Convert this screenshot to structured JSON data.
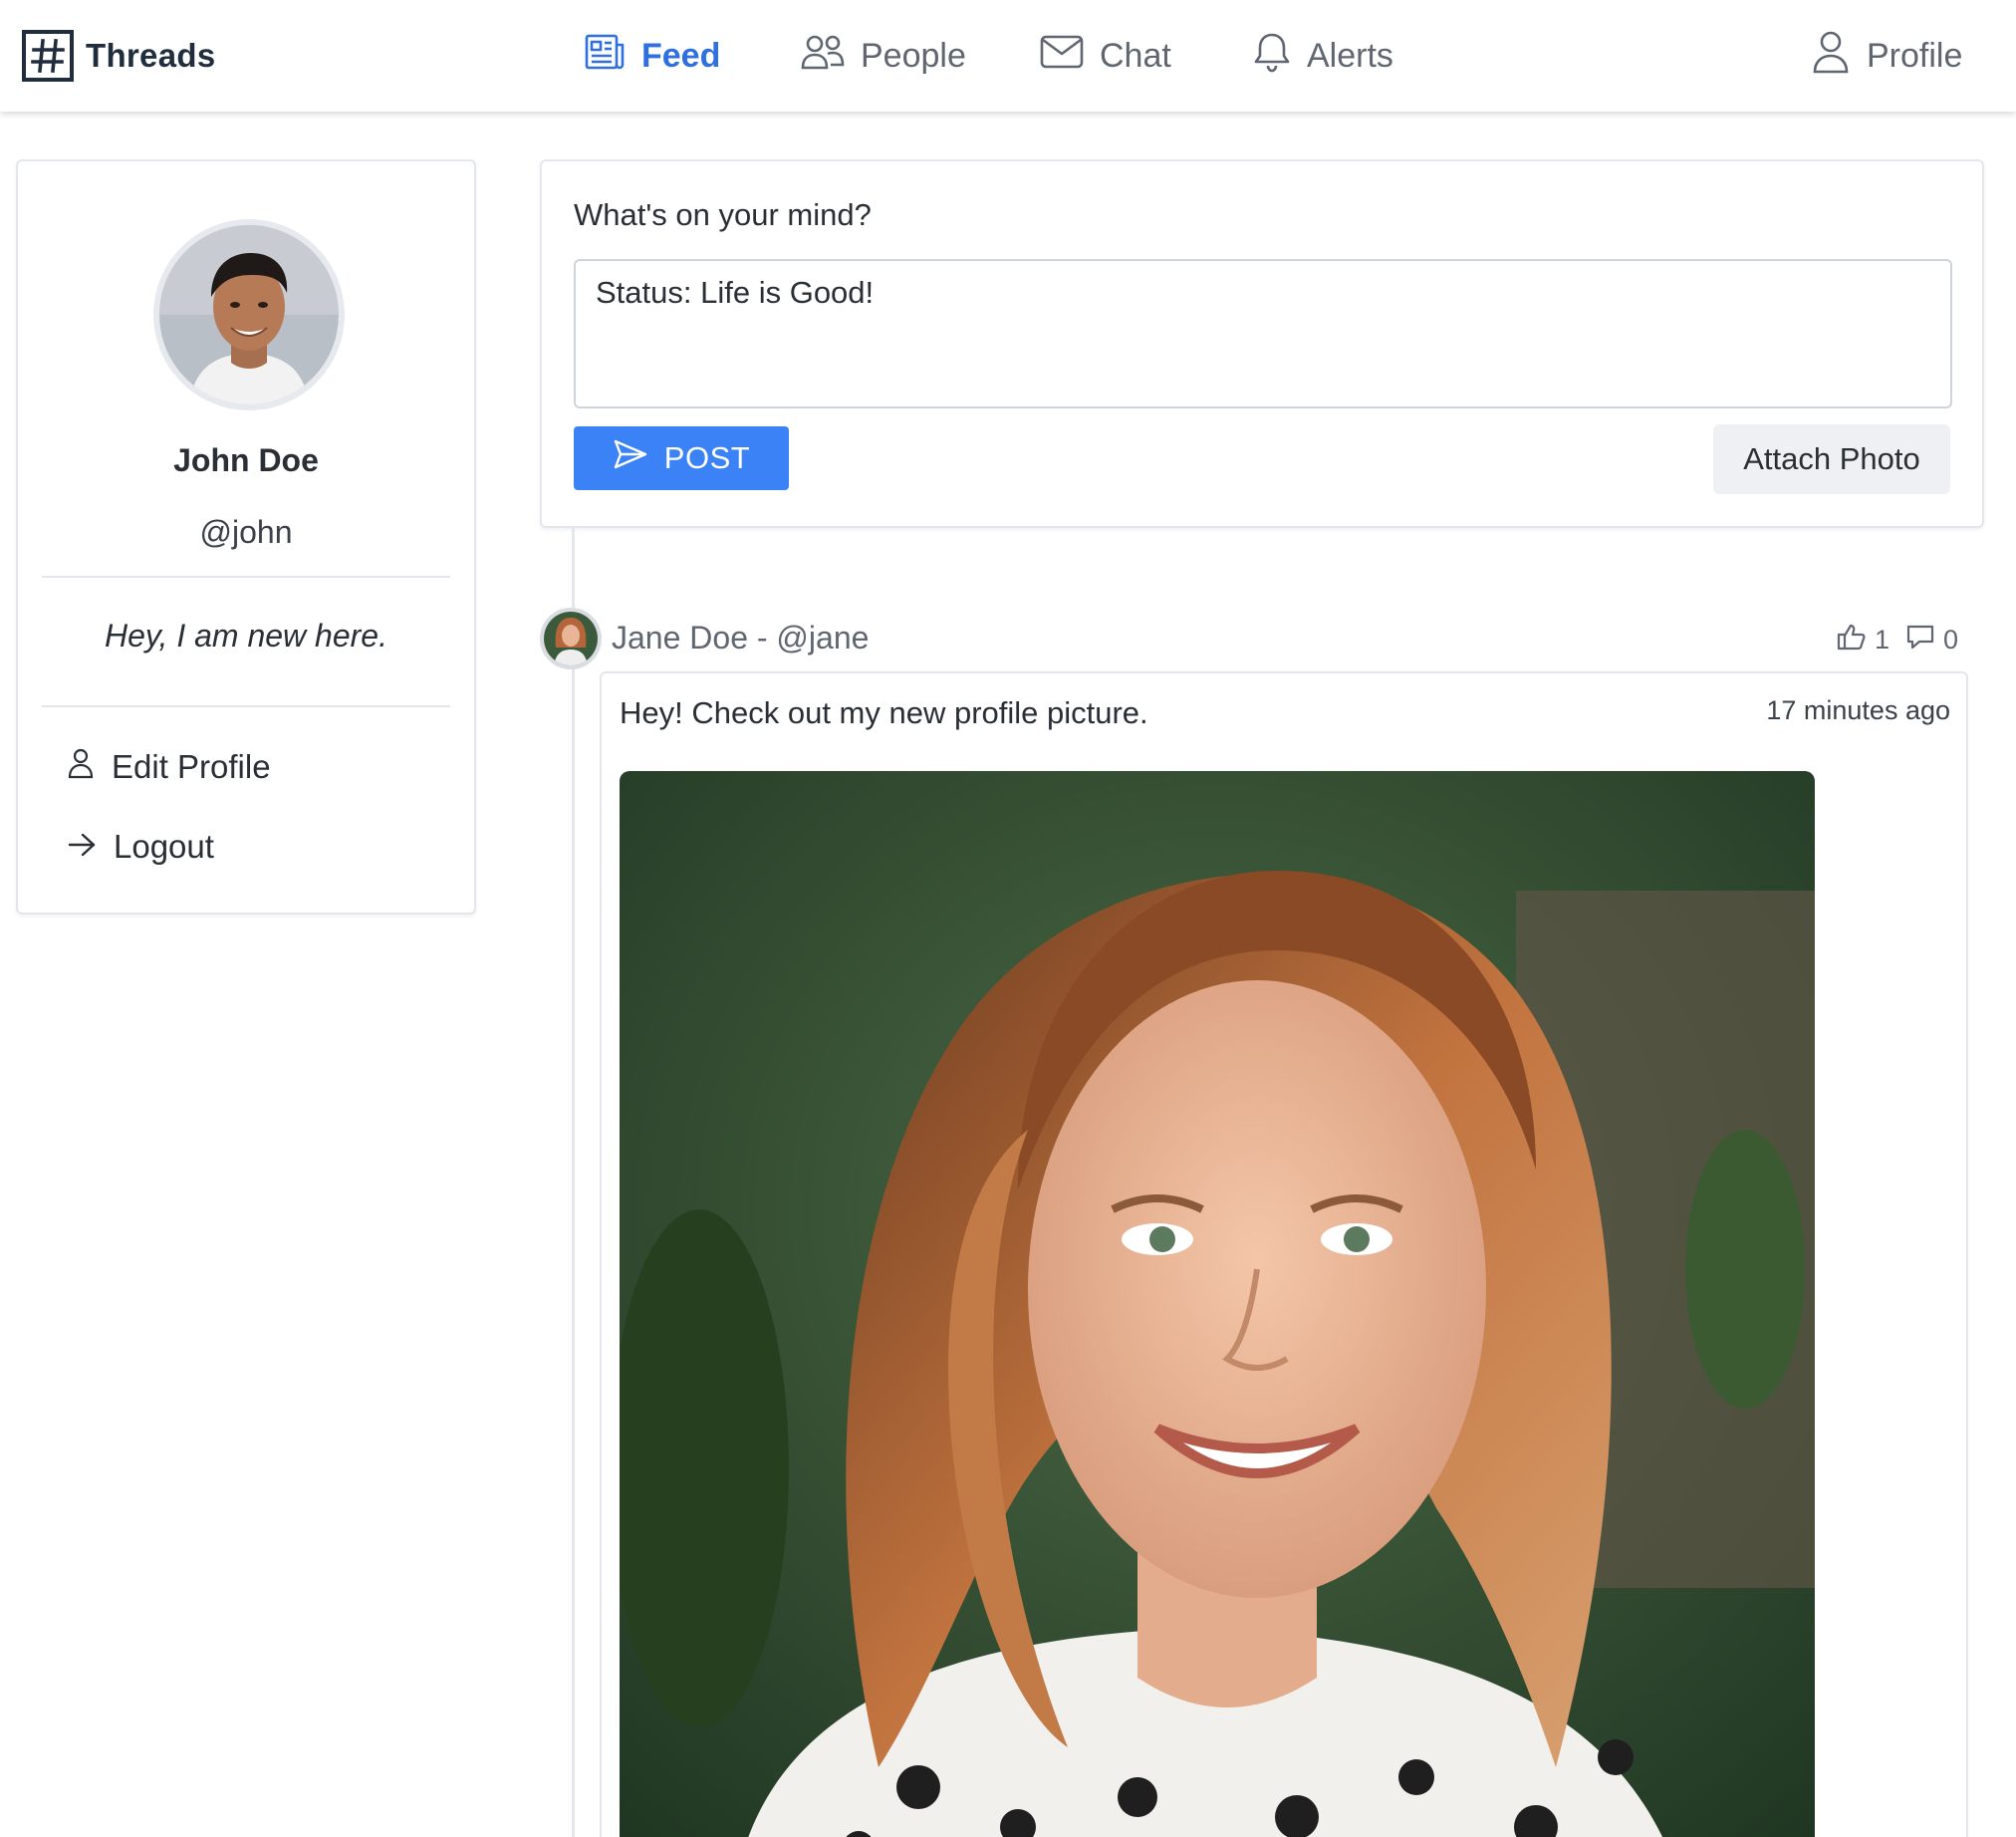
{
  "app": {
    "name": "Threads"
  },
  "nav": {
    "items": [
      {
        "label": "Feed",
        "icon": "newspaper-icon",
        "active": true
      },
      {
        "label": "People",
        "icon": "people-icon",
        "active": false
      },
      {
        "label": "Chat",
        "icon": "envelope-icon",
        "active": false
      },
      {
        "label": "Alerts",
        "icon": "bell-icon",
        "active": false
      }
    ],
    "profile_label": "Profile"
  },
  "profile": {
    "name": "John Doe",
    "handle": "@john",
    "bio": "Hey, I am new here.",
    "links": [
      {
        "label": "Edit Profile",
        "icon": "person-icon"
      },
      {
        "label": "Logout",
        "icon": "arrow-right-icon"
      }
    ]
  },
  "composer": {
    "prompt": "What's on your mind?",
    "value": "Status: Life is Good!",
    "post_label": "POST",
    "attach_label": "Attach Photo"
  },
  "feed": {
    "posts": [
      {
        "author": "Jane Doe - @jane",
        "likes": "1",
        "comments": "0",
        "text": "Hey! Check out my new profile picture.",
        "time": "17 minutes ago"
      }
    ]
  },
  "colors": {
    "accent": "#3b82f6",
    "nav_active": "#2f6fe0",
    "border": "#e3e6ea",
    "muted_text": "#5f6670"
  }
}
